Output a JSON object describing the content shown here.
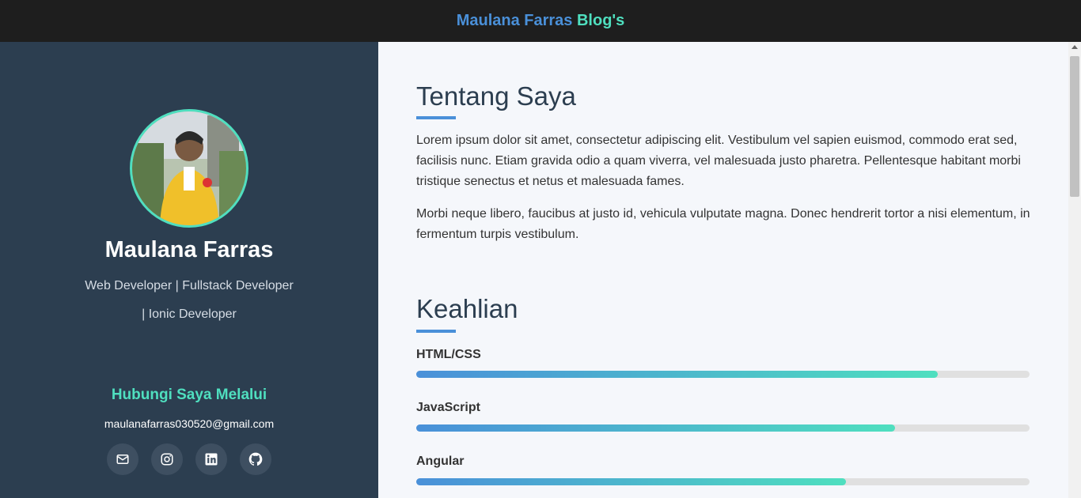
{
  "header": {
    "brand_name": "Maulana Farras",
    "brand_suffix": "Blog's"
  },
  "sidebar": {
    "name": "Maulana Farras",
    "role_line1": "Web Developer | Fullstack Developer",
    "role_line2": "| Ionic Developer",
    "contact_title": "Hubungi Saya Melalui",
    "email": "maulanafarras030520@gmail.com",
    "socials": [
      {
        "icon": "mail-icon"
      },
      {
        "icon": "instagram-icon"
      },
      {
        "icon": "linkedin-icon"
      },
      {
        "icon": "github-icon"
      }
    ]
  },
  "about": {
    "title": "Tentang Saya",
    "paragraph1": "Lorem ipsum dolor sit amet, consectetur adipiscing elit. Vestibulum vel sapien euismod, commodo erat sed, facilisis nunc. Etiam gravida odio a quam viverra, vel malesuada justo pharetra. Pellentesque habitant morbi tristique senectus et netus et malesuada fames.",
    "paragraph2": "Morbi neque libero, faucibus at justo id, vehicula vulputate magna. Donec hendrerit tortor a nisi elementum, in fermentum turpis vestibulum."
  },
  "skills": {
    "title": "Keahlian",
    "items": [
      {
        "label": "HTML/CSS",
        "level": 85
      },
      {
        "label": "JavaScript",
        "level": 78
      },
      {
        "label": "Angular",
        "level": 70
      }
    ]
  },
  "colors": {
    "accent_blue": "#4a90d9",
    "accent_teal": "#4fdfbf",
    "sidebar_bg": "#2c3e50",
    "topbar_bg": "#1e1e1e"
  }
}
